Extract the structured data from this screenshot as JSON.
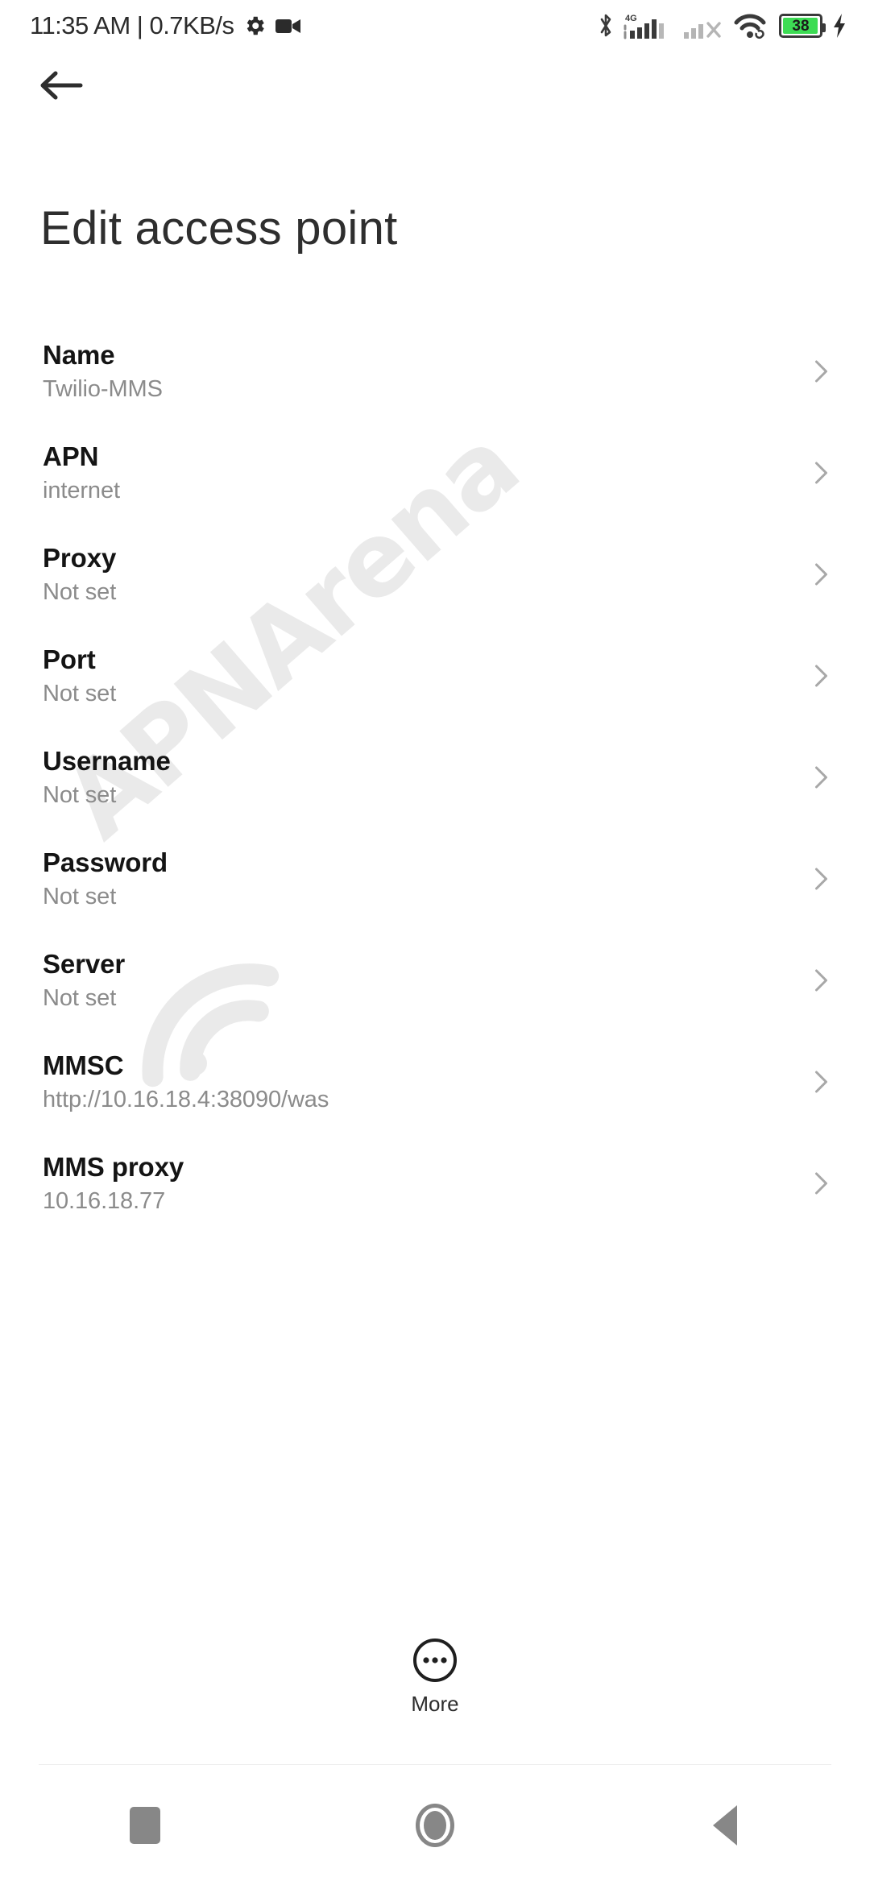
{
  "status_bar": {
    "time": "11:35 AM",
    "separator": "|",
    "network_speed": "0.7KB/s",
    "time_full": "11:35 AM | 0.7KB/s",
    "icons": [
      "gear-icon",
      "video-camera-icon",
      "bluetooth-icon",
      "signal-4g-icon",
      "signal-sim2-off-icon",
      "wifi-icon",
      "battery-icon",
      "charging-bolt-icon"
    ],
    "network_type": "4G",
    "battery_percent": "38",
    "battery_fill_pct": 38,
    "battery_color": "#3ddc54",
    "charging": true
  },
  "header": {
    "back_icon": "back-arrow-icon",
    "title": "Edit access point"
  },
  "settings": {
    "rows": [
      {
        "title": "Name",
        "value": "Twilio-MMS"
      },
      {
        "title": "APN",
        "value": "internet"
      },
      {
        "title": "Proxy",
        "value": "Not set"
      },
      {
        "title": "Port",
        "value": "Not set"
      },
      {
        "title": "Username",
        "value": "Not set"
      },
      {
        "title": "Password",
        "value": "Not set"
      },
      {
        "title": "Server",
        "value": "Not set"
      },
      {
        "title": "MMSC",
        "value": "http://10.16.18.4:38090/was"
      },
      {
        "title": "MMS proxy",
        "value": "10.16.18.77"
      }
    ]
  },
  "more_button": {
    "label": "More",
    "icon": "more-circle-icon"
  },
  "navigation_bar": {
    "recents_icon": "square-recents-icon",
    "home_icon": "circle-home-icon",
    "back_icon": "triangle-back-icon"
  },
  "watermark": {
    "text": "APNArena",
    "color": "#eaeaea"
  },
  "theme": {
    "background": "#ffffff",
    "title_color": "#2e2e2e",
    "row_title_color": "#141414",
    "row_value_color": "#8b8b8b",
    "chevron_color": "#a8a8a8",
    "nav_icon_color": "#878787"
  }
}
